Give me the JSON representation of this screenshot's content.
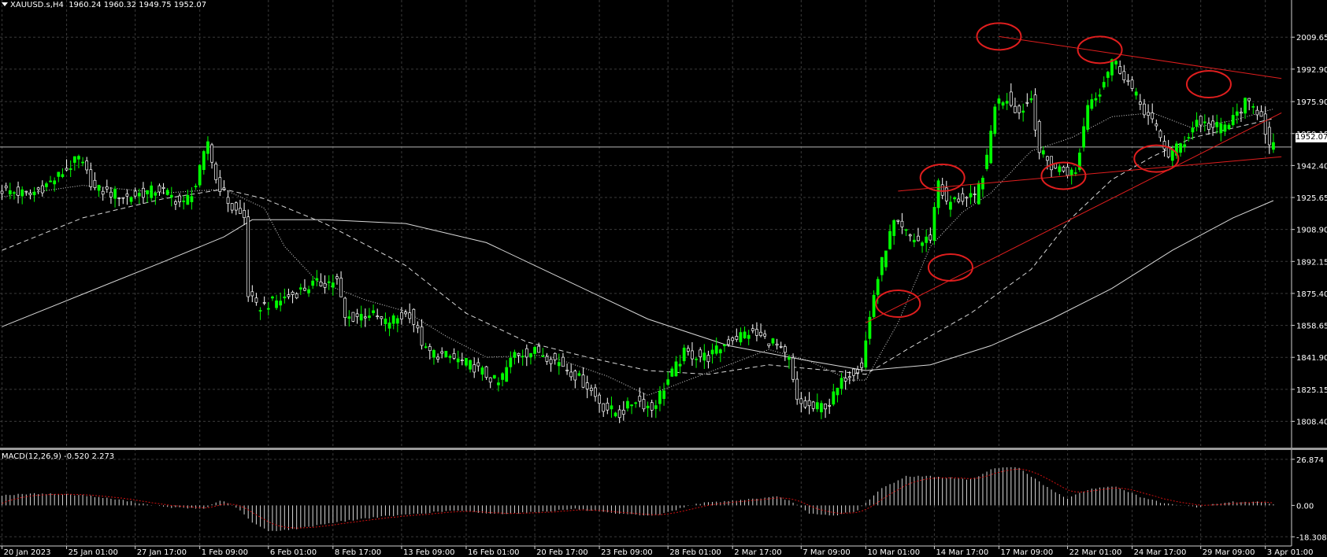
{
  "header": {
    "symbol": "XAUUSD.s,H4",
    "ohlc": "1960.24 1960.32 1949.75 1952.07"
  },
  "macd": {
    "label": "MACD(12,26,9) -0.520 2.273"
  },
  "colors": {
    "background": "#000000",
    "grid": "#3a3a3a",
    "bull": "#00ff00",
    "bear": "#ffffff",
    "annotation": "#e01e1e",
    "signal": "#d01010"
  },
  "chart_data": [
    {
      "type": "candlestick",
      "title": "XAUUSD.s,H4",
      "current_price": 1952.07,
      "current_price_label": "1952.07",
      "ylim": [
        1795,
        2025
      ],
      "y_ticks": [
        2009.65,
        1992.9,
        1975.9,
        1959.15,
        1942.4,
        1925.65,
        1908.9,
        1892.15,
        1875.4,
        1858.65,
        1841.9,
        1825.15,
        1808.4
      ],
      "y_tick_labels": [
        "2009.65",
        "1992.90",
        "1975.90",
        "1959.15",
        "1942.40",
        "1925.65",
        "1908.90",
        "1892.15",
        "1875.40",
        "1858.65",
        "1841.90",
        "1825.15",
        "1808.40"
      ],
      "x_ticks": [
        0,
        16,
        33,
        49,
        66,
        82,
        99,
        115,
        132,
        148,
        165,
        181,
        198,
        214,
        231,
        247,
        264,
        280,
        297,
        313
      ],
      "x_labels": [
        "20 Jan 2023",
        "25 Jan 01:00",
        "27 Jan 17:00",
        "1 Feb 09:00",
        "6 Feb 01:00",
        "8 Feb 17:00",
        "13 Feb 09:00",
        "16 Feb 01:00",
        "20 Feb 17:00",
        "23 Feb 09:00",
        "28 Feb 01:00",
        "2 Mar 17:00",
        "7 Mar 09:00",
        "10 Mar 01:00",
        "14 Mar 17:00",
        "17 Mar 09:00",
        "22 Mar 01:00",
        "24 Mar 17:00",
        "29 Mar 09:00",
        "3 Apr 01:00"
      ],
      "price_path": [
        [
          0,
          1930
        ],
        [
          8,
          1927
        ],
        [
          14,
          1935
        ],
        [
          20,
          1946
        ],
        [
          24,
          1930
        ],
        [
          32,
          1926
        ],
        [
          40,
          1930
        ],
        [
          46,
          1922
        ],
        [
          49,
          1932
        ],
        [
          52,
          1955
        ],
        [
          54,
          1935
        ],
        [
          58,
          1920
        ],
        [
          61,
          1915
        ],
        [
          62,
          1875
        ],
        [
          64,
          1868
        ],
        [
          70,
          1872
        ],
        [
          78,
          1880
        ],
        [
          84,
          1882
        ],
        [
          86,
          1862
        ],
        [
          92,
          1865
        ],
        [
          96,
          1860
        ],
        [
          102,
          1865
        ],
        [
          106,
          1845
        ],
        [
          112,
          1842
        ],
        [
          118,
          1837
        ],
        [
          124,
          1828
        ],
        [
          128,
          1844
        ],
        [
          134,
          1845
        ],
        [
          140,
          1838
        ],
        [
          146,
          1827
        ],
        [
          150,
          1816
        ],
        [
          154,
          1812
        ],
        [
          158,
          1820
        ],
        [
          162,
          1815
        ],
        [
          166,
          1830
        ],
        [
          170,
          1844
        ],
        [
          176,
          1842
        ],
        [
          182,
          1852
        ],
        [
          186,
          1855
        ],
        [
          192,
          1850
        ],
        [
          196,
          1840
        ],
        [
          198,
          1818
        ],
        [
          202,
          1815
        ],
        [
          206,
          1818
        ],
        [
          210,
          1832
        ],
        [
          214,
          1838
        ],
        [
          217,
          1875
        ],
        [
          220,
          1900
        ],
        [
          222,
          1912
        ],
        [
          226,
          1905
        ],
        [
          229,
          1902
        ],
        [
          231,
          1905
        ],
        [
          233,
          1935
        ],
        [
          235,
          1922
        ],
        [
          238,
          1925
        ],
        [
          242,
          1925
        ],
        [
          245,
          1945
        ],
        [
          247,
          1975
        ],
        [
          250,
          1978
        ],
        [
          253,
          1970
        ],
        [
          256,
          1978
        ],
        [
          258,
          1950
        ],
        [
          261,
          1942
        ],
        [
          264,
          1940
        ],
        [
          267,
          1938
        ],
        [
          270,
          1975
        ],
        [
          273,
          1982
        ],
        [
          276,
          1998
        ],
        [
          279,
          1990
        ],
        [
          282,
          1978
        ],
        [
          286,
          1965
        ],
        [
          290,
          1948
        ],
        [
          294,
          1955
        ],
        [
          297,
          1966
        ],
        [
          301,
          1962
        ],
        [
          305,
          1964
        ],
        [
          309,
          1975
        ],
        [
          313,
          1970
        ],
        [
          315,
          1952
        ]
      ],
      "moving_averages": [
        {
          "style": "dotted",
          "points": [
            [
              0,
              1926
            ],
            [
              20,
              1932
            ],
            [
              40,
              1928
            ],
            [
              55,
              1930
            ],
            [
              65,
              1920
            ],
            [
              70,
              1900
            ],
            [
              78,
              1882
            ],
            [
              90,
              1872
            ],
            [
              100,
              1866
            ],
            [
              110,
              1853
            ],
            [
              120,
              1842
            ],
            [
              135,
              1843
            ],
            [
              150,
              1832
            ],
            [
              160,
              1822
            ],
            [
              170,
              1830
            ],
            [
              180,
              1838
            ],
            [
              190,
              1846
            ],
            [
              200,
              1840
            ],
            [
              210,
              1830
            ],
            [
              214,
              1830
            ],
            [
              222,
              1860
            ],
            [
              230,
              1900
            ],
            [
              238,
              1918
            ],
            [
              245,
              1928
            ],
            [
              255,
              1950
            ],
            [
              265,
              1957
            ],
            [
              275,
              1968
            ],
            [
              285,
              1970
            ],
            [
              295,
              1962
            ],
            [
              305,
              1966
            ],
            [
              315,
              1972
            ]
          ]
        },
        {
          "style": "dashed",
          "points": [
            [
              0,
              1898
            ],
            [
              20,
              1915
            ],
            [
              40,
              1925
            ],
            [
              55,
              1930
            ],
            [
              65,
              1925
            ],
            [
              80,
              1912
            ],
            [
              100,
              1890
            ],
            [
              115,
              1865
            ],
            [
              130,
              1850
            ],
            [
              145,
              1842
            ],
            [
              160,
              1835
            ],
            [
              175,
              1833
            ],
            [
              190,
              1838
            ],
            [
              205,
              1835
            ],
            [
              214,
              1833
            ],
            [
              225,
              1847
            ],
            [
              240,
              1865
            ],
            [
              255,
              1888
            ],
            [
              265,
              1915
            ],
            [
              275,
              1935
            ],
            [
              285,
              1947
            ],
            [
              295,
              1957
            ],
            [
              305,
              1962
            ],
            [
              315,
              1967
            ]
          ]
        },
        {
          "style": "solid",
          "points": [
            [
              0,
              1858
            ],
            [
              20,
              1875
            ],
            [
              40,
              1892
            ],
            [
              55,
              1905
            ],
            [
              62,
              1914
            ],
            [
              80,
              1914
            ],
            [
              100,
              1912
            ],
            [
              120,
              1902
            ],
            [
              140,
              1882
            ],
            [
              160,
              1862
            ],
            [
              180,
              1848
            ],
            [
              200,
              1840
            ],
            [
              214,
              1835
            ],
            [
              230,
              1838
            ],
            [
              245,
              1848
            ],
            [
              260,
              1862
            ],
            [
              275,
              1878
            ],
            [
              290,
              1898
            ],
            [
              305,
              1915
            ],
            [
              315,
              1924
            ]
          ]
        }
      ],
      "trendlines": [
        {
          "from": [
            247,
            2010
          ],
          "to": [
            317,
            1988
          ]
        },
        {
          "from": [
            222,
            1929
          ],
          "to": [
            317,
            1947
          ]
        },
        {
          "from": [
            214,
            1860
          ],
          "to": [
            317,
            1970
          ]
        }
      ],
      "circled_points": [
        [
          247,
          2010
        ],
        [
          272,
          2003
        ],
        [
          299,
          1985
        ],
        [
          222,
          1870
        ],
        [
          233,
          1936
        ],
        [
          235,
          1889
        ],
        [
          263,
          1937
        ],
        [
          286,
          1946
        ]
      ]
    },
    {
      "type": "histogram",
      "title": "MACD(12,26,9)",
      "main": -0.52,
      "signal": 2.273,
      "ylim": [
        -20,
        30
      ],
      "y_ticks": [
        26.874,
        0.0,
        -18.308
      ],
      "y_tick_labels": [
        "26.874",
        "0.00",
        "-18.308"
      ],
      "histogram_path": [
        [
          0,
          6
        ],
        [
          10,
          7
        ],
        [
          20,
          6
        ],
        [
          30,
          3
        ],
        [
          40,
          -1
        ],
        [
          50,
          -2
        ],
        [
          54,
          3
        ],
        [
          58,
          -1
        ],
        [
          62,
          -10
        ],
        [
          66,
          -15
        ],
        [
          72,
          -14
        ],
        [
          82,
          -10
        ],
        [
          92,
          -7
        ],
        [
          102,
          -5
        ],
        [
          112,
          -3
        ],
        [
          122,
          -5
        ],
        [
          132,
          -4
        ],
        [
          142,
          -2
        ],
        [
          152,
          -5
        ],
        [
          162,
          -6
        ],
        [
          172,
          1
        ],
        [
          182,
          3
        ],
        [
          192,
          5
        ],
        [
          196,
          2
        ],
        [
          200,
          -5
        ],
        [
          206,
          -6
        ],
        [
          212,
          -3
        ],
        [
          218,
          10
        ],
        [
          224,
          17
        ],
        [
          230,
          17
        ],
        [
          240,
          15
        ],
        [
          246,
          22
        ],
        [
          252,
          22
        ],
        [
          258,
          12
        ],
        [
          264,
          4
        ],
        [
          270,
          10
        ],
        [
          276,
          11
        ],
        [
          282,
          5
        ],
        [
          288,
          1
        ],
        [
          296,
          -1
        ],
        [
          304,
          2
        ],
        [
          312,
          2
        ],
        [
          315,
          1
        ]
      ]
    }
  ]
}
